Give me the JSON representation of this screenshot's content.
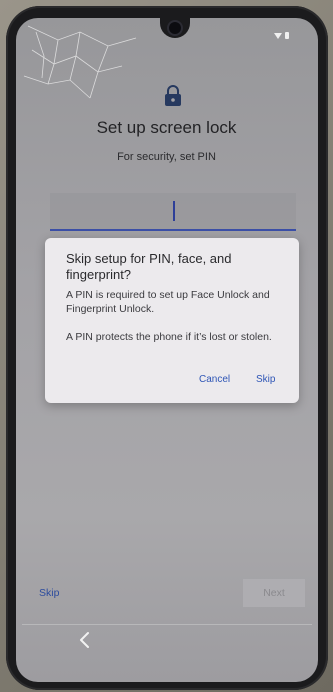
{
  "setup": {
    "title": "Set up screen lock",
    "subtitle": "For security, set PIN",
    "pin_value": ""
  },
  "dialog": {
    "title": "Skip setup for PIN, face, and fingerprint?",
    "body1": "A PIN is required to set up Face Unlock and Fingerprint Unlock.",
    "body2": "A PIN protects the phone if it’s lost or stolen.",
    "cancel": "Cancel",
    "skip": "Skip"
  },
  "footer": {
    "skip": "Skip",
    "next": "Next"
  },
  "icons": {
    "lock": "lock-icon",
    "back": "back-icon",
    "wifi": "wifi-icon",
    "battery": "battery-icon"
  },
  "colors": {
    "accent": "#2f56b6",
    "pin_underline": "#3a4ea6",
    "dialog_bg": "#eceaed",
    "screen_bg": "#a3a2a6"
  }
}
